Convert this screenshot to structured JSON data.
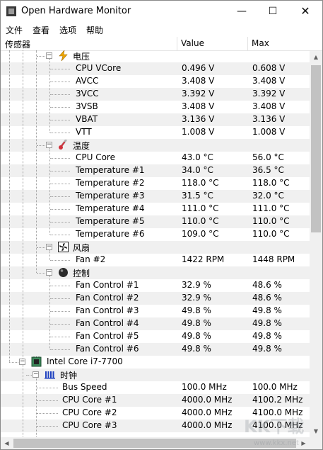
{
  "window": {
    "title": "Open Hardware Monitor",
    "min_glyph": "—",
    "max_glyph": "☐",
    "close_glyph": "✕"
  },
  "menu": {
    "items": [
      "文件",
      "查看",
      "选项",
      "帮助"
    ]
  },
  "columns": {
    "sensor": "传感器",
    "value": "Value",
    "max": "Max"
  },
  "groups": {
    "voltage": {
      "label": "电压",
      "icon": "lightning-icon",
      "rows": [
        {
          "name": "CPU VCore",
          "value": "0.496 V",
          "max": "0.608 V"
        },
        {
          "name": "AVCC",
          "value": "3.408 V",
          "max": "3.408 V"
        },
        {
          "name": "3VCC",
          "value": "3.392 V",
          "max": "3.392 V"
        },
        {
          "name": "3VSB",
          "value": "3.408 V",
          "max": "3.408 V"
        },
        {
          "name": "VBAT",
          "value": "3.136 V",
          "max": "3.136 V"
        },
        {
          "name": "VTT",
          "value": "1.008 V",
          "max": "1.008 V"
        }
      ]
    },
    "temperature": {
      "label": "温度",
      "icon": "thermometer-icon",
      "rows": [
        {
          "name": "CPU Core",
          "value": "43.0 °C",
          "max": "56.0 °C"
        },
        {
          "name": "Temperature #1",
          "value": "34.0 °C",
          "max": "36.5 °C"
        },
        {
          "name": "Temperature #2",
          "value": "118.0 °C",
          "max": "118.0 °C"
        },
        {
          "name": "Temperature #3",
          "value": "31.5 °C",
          "max": "32.0 °C"
        },
        {
          "name": "Temperature #4",
          "value": "111.0 °C",
          "max": "111.0 °C"
        },
        {
          "name": "Temperature #5",
          "value": "110.0 °C",
          "max": "110.0 °C"
        },
        {
          "name": "Temperature #6",
          "value": "109.0 °C",
          "max": "110.0 °C"
        }
      ]
    },
    "fans": {
      "label": "风扇",
      "icon": "fan-icon",
      "rows": [
        {
          "name": "Fan #2",
          "value": "1422 RPM",
          "max": "1448 RPM"
        }
      ]
    },
    "controls": {
      "label": "控制",
      "icon": "control-knob-icon",
      "rows": [
        {
          "name": "Fan Control #1",
          "value": "32.9 %",
          "max": "48.6 %"
        },
        {
          "name": "Fan Control #2",
          "value": "32.9 %",
          "max": "48.6 %"
        },
        {
          "name": "Fan Control #3",
          "value": "49.8 %",
          "max": "49.8 %"
        },
        {
          "name": "Fan Control #4",
          "value": "49.8 %",
          "max": "49.8 %"
        },
        {
          "name": "Fan Control #5",
          "value": "49.8 %",
          "max": "49.8 %"
        },
        {
          "name": "Fan Control #6",
          "value": "49.8 %",
          "max": "49.8 %"
        }
      ]
    }
  },
  "cpu": {
    "label": "Intel Core i7-7700",
    "icon": "cpu-chip-icon",
    "clocks": {
      "label": "时钟",
      "icon": "clock-bars-icon",
      "rows": [
        {
          "name": "Bus Speed",
          "value": "100.0 MHz",
          "max": "100.0 MHz"
        },
        {
          "name": "CPU Core #1",
          "value": "4000.0 MHz",
          "max": "4100.2 MHz"
        },
        {
          "name": "CPU Core #2",
          "value": "4000.0 MHz",
          "max": "4100.0 MHz"
        },
        {
          "name": "CPU Core #3",
          "value": "4000.0 MHz",
          "max": "4100.0 MHz"
        }
      ]
    }
  },
  "watermark": {
    "text": "www.kkx.net"
  },
  "colors": {
    "alt_row": "#f0f0f0",
    "lightning": "#f0a800",
    "thermometer": "#d0303a",
    "scroll_thumb": "#c2c2c2"
  }
}
